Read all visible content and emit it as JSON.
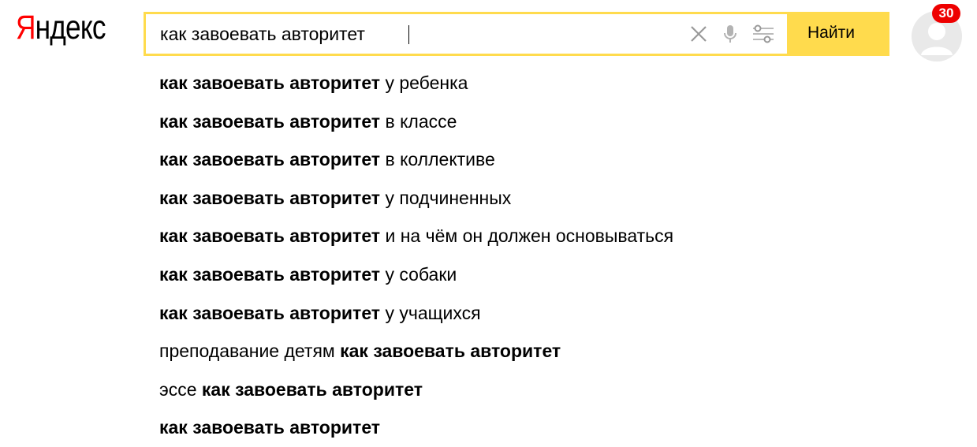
{
  "logo": {
    "first": "Я",
    "rest": "ндекс"
  },
  "search": {
    "value": "как завоевать авторитет"
  },
  "search_button": {
    "label": "Найти"
  },
  "notifications": {
    "count": "30"
  },
  "icons": [
    "clear-icon",
    "microphone-icon",
    "settings-sliders-icon",
    "avatar-user-icon"
  ],
  "colors": {
    "accent": "#ffdb4d",
    "logo_red": "#ff0000",
    "badge": "#ee0000"
  },
  "suggestions": [
    {
      "bold": "как завоевать авторитет",
      "rest": " у ребенка"
    },
    {
      "bold": "как завоевать авторитет",
      "rest": " в классе"
    },
    {
      "bold": "как завоевать авторитет",
      "rest": " в коллективе"
    },
    {
      "bold": "как завоевать авторитет",
      "rest": " у подчиненных"
    },
    {
      "bold": "как завоевать авторитет",
      "rest": " и на чём он должен основываться"
    },
    {
      "bold": "как завоевать авторитет",
      "rest": " у собаки"
    },
    {
      "bold": "как завоевать авторитет",
      "rest": " у учащихся"
    },
    {
      "pre": "преподавание детям ",
      "bold": "как завоевать авторитет"
    },
    {
      "pre": "эссе ",
      "bold": "как завоевать авторитет"
    },
    {
      "bold": "как завоевать авторитет"
    }
  ]
}
